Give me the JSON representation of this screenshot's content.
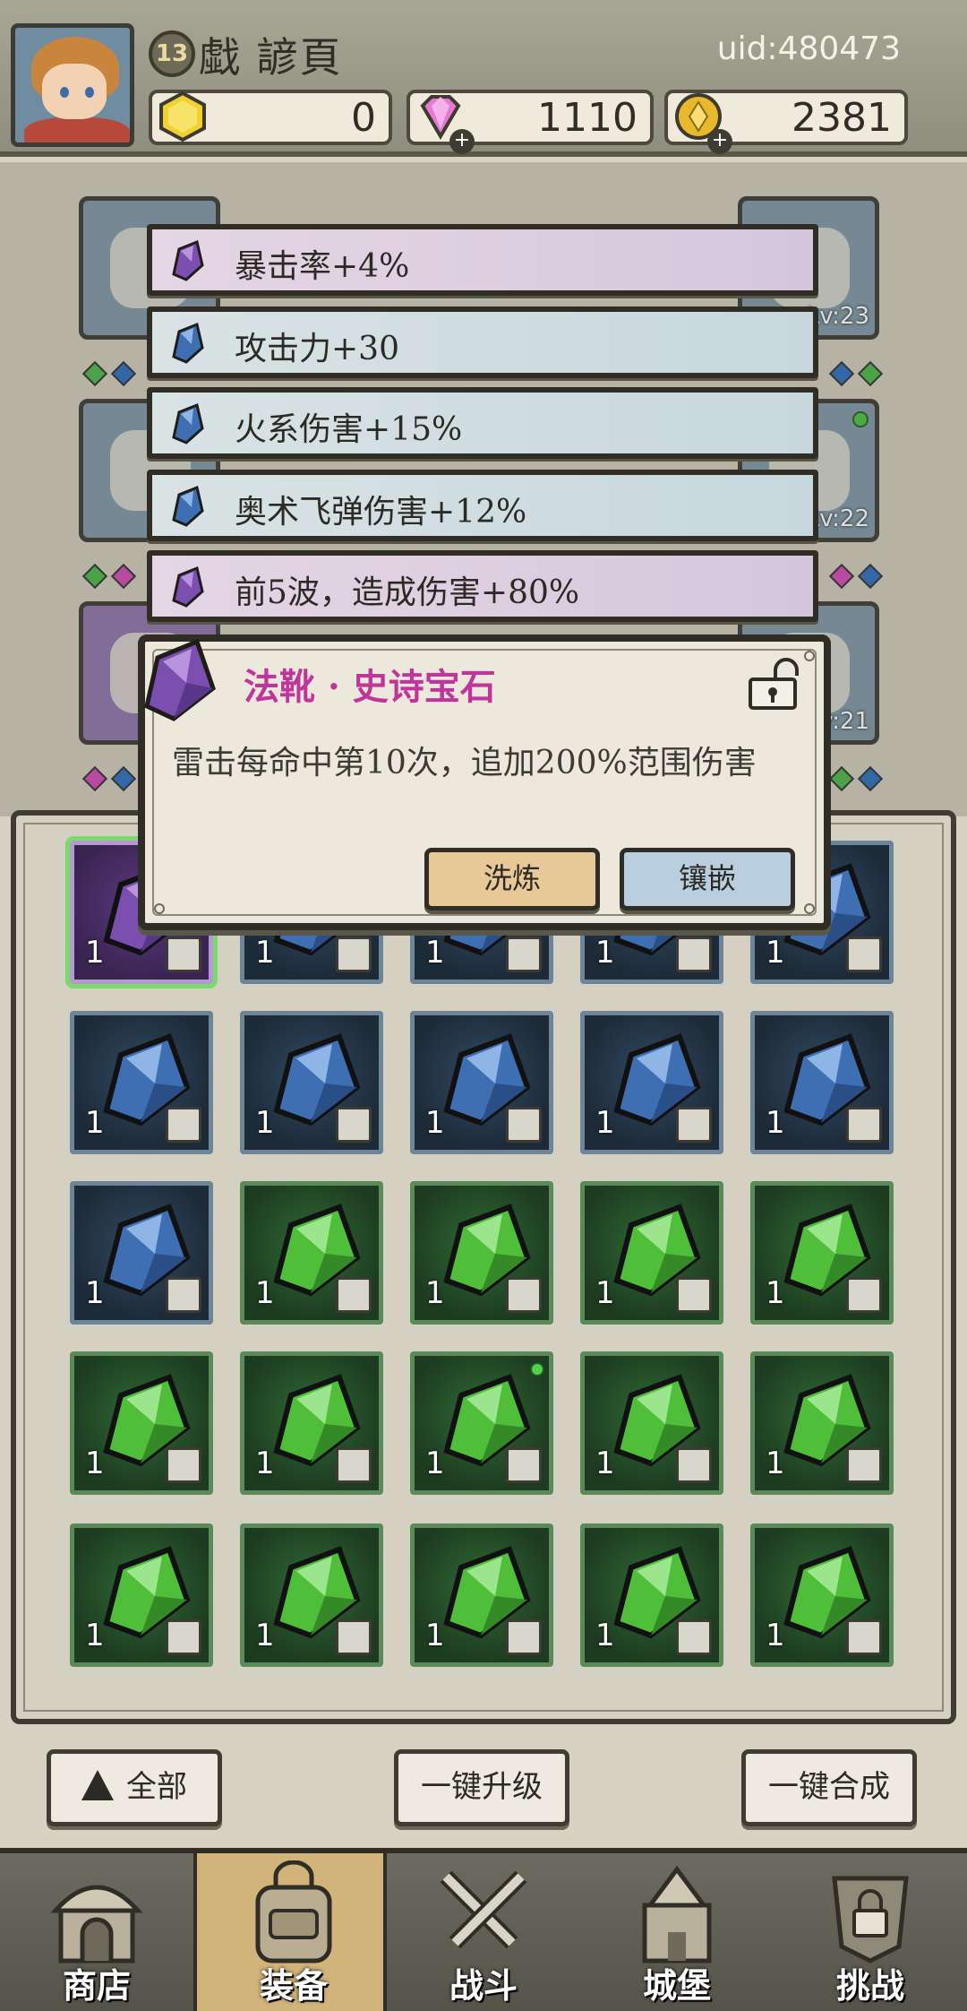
{
  "player": {
    "level": "13",
    "name": "戱 諺頁",
    "uid": "uid:480473"
  },
  "resources": [
    {
      "icon": "gold-hexagon-icon",
      "value": "0"
    },
    {
      "icon": "pink-diamond-icon",
      "value": "1110"
    },
    {
      "icon": "gold-coin-icon",
      "value": "2381"
    }
  ],
  "equipment_levels": [
    "Lv:23",
    "Lv:22",
    "Lv:21"
  ],
  "stats": [
    {
      "text": "暴击率+4%",
      "gem": "purple"
    },
    {
      "text": "攻击力+30",
      "gem": "blue"
    },
    {
      "text": "火系伤害+15%",
      "gem": "blue"
    },
    {
      "text": "奥术飞弹伤害+12%",
      "gem": "blue"
    },
    {
      "text": "前5波，造成伤害+80%",
      "gem": "purple"
    }
  ],
  "popup": {
    "title": "法靴 · 史诗宝石",
    "description": "雷击每命中第10次，追加200%范围伤害",
    "refine_label": "洗炼",
    "inlay_label": "镶嵌"
  },
  "inventory": [
    [
      {
        "color": "purple",
        "count": "1",
        "tag": "boot"
      },
      {
        "color": "blue",
        "count": "1",
        "tag": "ring"
      },
      {
        "color": "blue",
        "count": "1",
        "tag": "ring"
      },
      {
        "color": "blue",
        "count": "1",
        "tag": "ring"
      },
      {
        "color": "blue",
        "count": "1",
        "tag": "cape"
      }
    ],
    [
      {
        "color": "blue",
        "count": "1",
        "tag": "cape"
      },
      {
        "color": "blue",
        "count": "1",
        "tag": "staff"
      },
      {
        "color": "blue",
        "count": "1",
        "tag": "staff"
      },
      {
        "color": "blue",
        "count": "1",
        "tag": "staff"
      },
      {
        "color": "blue",
        "count": "1",
        "tag": "hat"
      }
    ],
    [
      {
        "color": "blue",
        "count": "1",
        "tag": "hat"
      },
      {
        "color": "green",
        "count": "1",
        "tag": "ring"
      },
      {
        "color": "green",
        "count": "1",
        "tag": "ring"
      },
      {
        "color": "green",
        "count": "1",
        "tag": "ring"
      },
      {
        "color": "green",
        "count": "1",
        "tag": "cape"
      }
    ],
    [
      {
        "color": "green",
        "count": "1",
        "tag": "cape"
      },
      {
        "color": "green",
        "count": "1",
        "tag": "cape"
      },
      {
        "color": "green",
        "count": "1",
        "tag": "cape"
      },
      {
        "color": "green",
        "count": "1",
        "tag": "staff"
      },
      {
        "color": "green",
        "count": "1",
        "tag": "hat"
      }
    ],
    [
      {
        "color": "green",
        "count": "1",
        "tag": "hat"
      },
      {
        "color": "green",
        "count": "1",
        "tag": "hat"
      },
      {
        "color": "green",
        "count": "1",
        "tag": "amulet"
      },
      {
        "color": "green",
        "count": "1",
        "tag": "amulet"
      },
      {
        "color": "green",
        "count": "1",
        "tag": "amulet"
      }
    ]
  ],
  "actions": {
    "filter_label": "全部",
    "upgrade_all_label": "一键升级",
    "merge_all_label": "一键合成"
  },
  "nav": [
    {
      "label": "商店",
      "icon": "shop-icon"
    },
    {
      "label": "装备",
      "icon": "backpack-icon",
      "active": true
    },
    {
      "label": "战斗",
      "icon": "crossed-swords-icon"
    },
    {
      "label": "城堡",
      "icon": "castle-icon"
    },
    {
      "label": "挑战",
      "icon": "locked-challenge-icon"
    }
  ],
  "colors": {
    "purple_gem": "#7b4fb0",
    "blue_gem": "#3f6fb3",
    "green_gem": "#4fbf3a",
    "title_pink": "#c0359a",
    "active_tab": "#d2b37a"
  }
}
